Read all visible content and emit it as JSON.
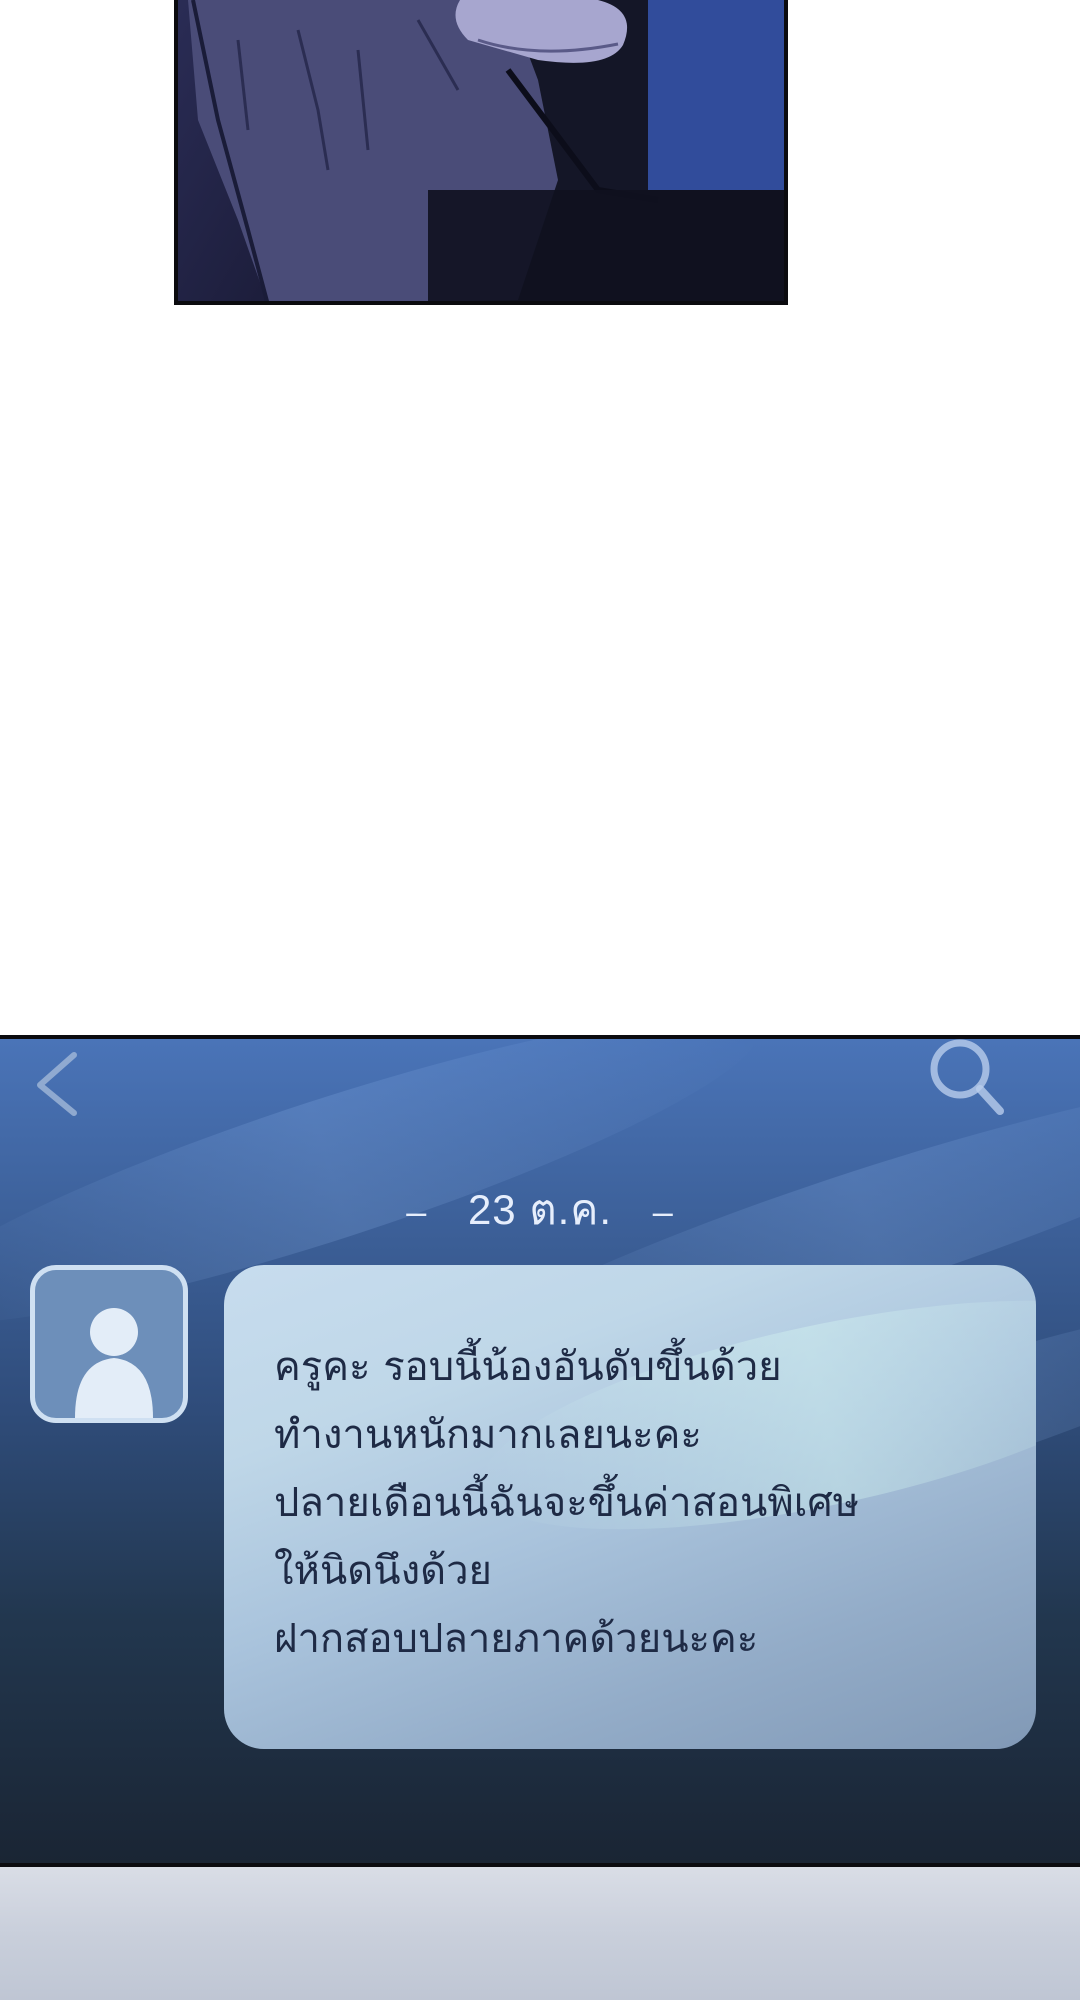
{
  "chat": {
    "date": "23 ต.ค.",
    "date_dash_left": "–",
    "date_dash_right": "–",
    "message_lines": [
      "ครูคะ รอบนี้น้องอันดับขึ้นด้วย",
      "ทำงานหนักมากเลยนะคะ",
      "ปลายเดือนนี้ฉันจะขึ้นค่าสอนพิเศษ",
      "ให้นิดนึงด้วย",
      "ฝากสอบปลายภาคด้วยนะคะ"
    ],
    "icons": {
      "back": "chevron-left-icon",
      "search": "search-icon",
      "avatar": "person-icon"
    }
  },
  "colors": {
    "chat_bg_top": "#4a74b8",
    "chat_bg_bottom": "#1a2534",
    "bubble": "#bfd7e8",
    "message_text": "#1e2a45",
    "date_text": "#e6eefc"
  }
}
